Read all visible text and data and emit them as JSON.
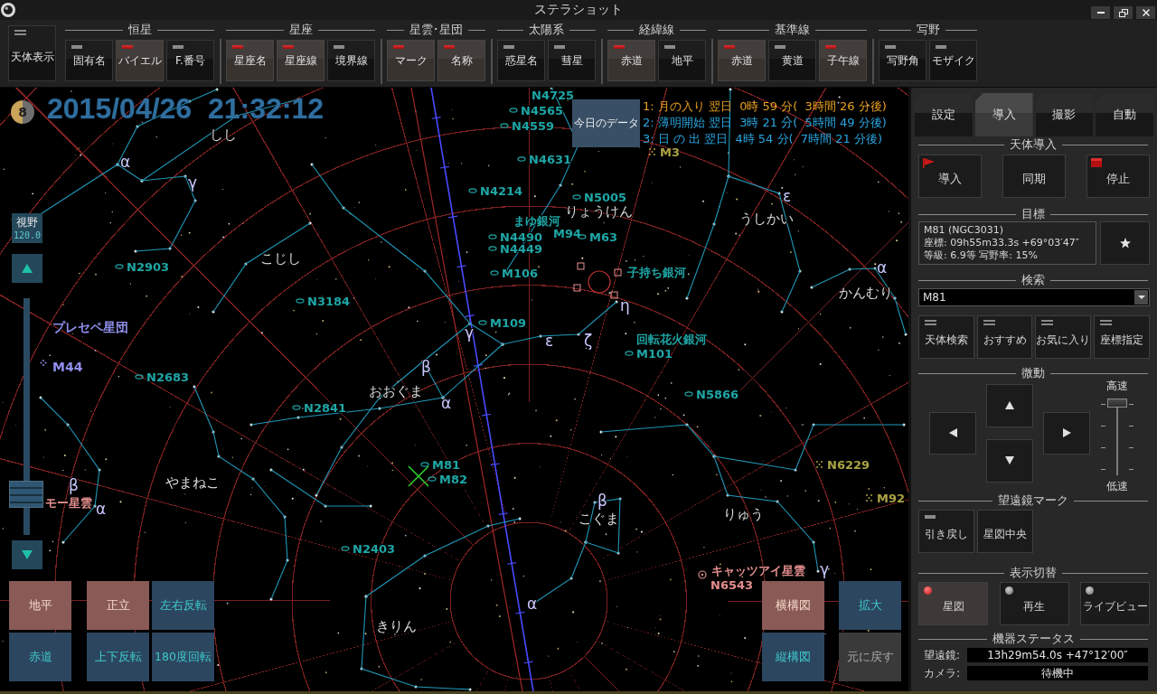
{
  "window": {
    "title": "ステラショット"
  },
  "toolbar": {
    "main": {
      "label": "天体表示",
      "on": false
    },
    "groups": [
      {
        "title": "恒星",
        "buttons": [
          {
            "label": "固有名",
            "on": false
          },
          {
            "label": "バイエル",
            "on": true
          },
          {
            "label": "F.番号",
            "on": false
          }
        ]
      },
      {
        "title": "星座",
        "buttons": [
          {
            "label": "星座名",
            "on": true
          },
          {
            "label": "星座線",
            "on": true
          },
          {
            "label": "境界線",
            "on": false
          }
        ]
      },
      {
        "title": "星雲･星団",
        "buttons": [
          {
            "label": "マーク",
            "on": true
          },
          {
            "label": "名称",
            "on": true
          }
        ]
      },
      {
        "title": "太陽系",
        "buttons": [
          {
            "label": "惑星名",
            "on": false
          },
          {
            "label": "彗星",
            "on": false
          }
        ]
      },
      {
        "title": "経緯線",
        "buttons": [
          {
            "label": "赤道",
            "on": true
          },
          {
            "label": "地平",
            "on": false
          }
        ]
      },
      {
        "title": "基準線",
        "buttons": [
          {
            "label": "赤道",
            "on": true
          },
          {
            "label": "黄道",
            "on": false
          },
          {
            "label": "子午線",
            "on": true
          }
        ]
      },
      {
        "title": "写野",
        "buttons": [
          {
            "label": "写野角",
            "on": false
          },
          {
            "label": "モザイク",
            "on": false
          }
        ]
      }
    ]
  },
  "chart": {
    "moon_age": "8",
    "datetime": "2015/04/26  21:32:12",
    "todays_data": "今日のデータ",
    "events": [
      {
        "text": "1: 月の入り 翌日  0時 59 分(  3時間 26 分後)",
        "color": "#e8a020"
      },
      {
        "text": "2: 薄明開始 翌日  3時 21 分(  5時間 49 分後)",
        "color": "#2aa6e0"
      },
      {
        "text": "3: 日 の 出 翌日  4時 54 分(  7時間 21 分後)",
        "color": "#2aa6e0"
      }
    ],
    "field_of_view": {
      "label": "視野",
      "value": "120.0"
    },
    "zoom_slider": {
      "level": 0.13
    },
    "labels": [
      {
        "text": "しし",
        "kind": "constellation"
      },
      {
        "text": "こじし",
        "kind": "constellation"
      },
      {
        "text": "りょうけん",
        "kind": "constellation"
      },
      {
        "text": "うしかい",
        "kind": "constellation"
      },
      {
        "text": "かんむり",
        "kind": "constellation"
      },
      {
        "text": "おおぐま",
        "kind": "constellation"
      },
      {
        "text": "やまねこ",
        "kind": "constellation"
      },
      {
        "text": "こぐま",
        "kind": "constellation"
      },
      {
        "text": "りゅう",
        "kind": "constellation"
      },
      {
        "text": "きりん",
        "kind": "constellation"
      },
      {
        "text": "N4725",
        "kind": "galaxy_name"
      },
      {
        "text": "N4565",
        "kind": "galaxy"
      },
      {
        "text": "N4559",
        "kind": "galaxy"
      },
      {
        "text": "N4631",
        "kind": "galaxy"
      },
      {
        "text": "N4214",
        "kind": "galaxy"
      },
      {
        "text": "N5005",
        "kind": "galaxy"
      },
      {
        "text": "まゆ銀河",
        "kind": "galaxy_name"
      },
      {
        "text": "N4490",
        "kind": "galaxy"
      },
      {
        "text": "M94",
        "kind": "galaxy_name"
      },
      {
        "text": "M63",
        "kind": "galaxy"
      },
      {
        "text": "N4449",
        "kind": "galaxy"
      },
      {
        "text": "M106",
        "kind": "galaxy"
      },
      {
        "text": "子持ち銀河",
        "kind": "galaxy_name"
      },
      {
        "text": "M109",
        "kind": "galaxy"
      },
      {
        "text": "回転花火銀河",
        "kind": "galaxy_name"
      },
      {
        "text": "M101",
        "kind": "galaxy"
      },
      {
        "text": "N3184",
        "kind": "galaxy"
      },
      {
        "text": "N2903",
        "kind": "galaxy"
      },
      {
        "text": "N2683",
        "kind": "galaxy"
      },
      {
        "text": "N2841",
        "kind": "galaxy"
      },
      {
        "text": "N5866",
        "kind": "galaxy"
      },
      {
        "text": "M81",
        "kind": "galaxy"
      },
      {
        "text": "M82",
        "kind": "galaxy"
      },
      {
        "text": "N2403",
        "kind": "galaxy"
      },
      {
        "text": "M3",
        "kind": "globular"
      },
      {
        "text": "N6229",
        "kind": "globular"
      },
      {
        "text": "M92",
        "kind": "globular"
      },
      {
        "text": "キャッツアイ星雲",
        "kind": "nebula_name"
      },
      {
        "text": "N6543",
        "kind": "nebula"
      },
      {
        "text": "プレセペ星団",
        "kind": "open_cluster_name"
      },
      {
        "text": "M44",
        "kind": "open_cluster"
      },
      {
        "text": "モー星雲",
        "kind": "nebula_name"
      },
      {
        "text": "α",
        "kind": "star"
      },
      {
        "text": "γ",
        "kind": "star"
      },
      {
        "text": "ε",
        "kind": "star"
      },
      {
        "text": "α",
        "kind": "star"
      },
      {
        "text": "η",
        "kind": "star"
      },
      {
        "text": "γ",
        "kind": "star"
      },
      {
        "text": "ε",
        "kind": "star"
      },
      {
        "text": "ζ",
        "kind": "star"
      },
      {
        "text": "β",
        "kind": "star"
      },
      {
        "text": "α",
        "kind": "star"
      },
      {
        "text": "β",
        "kind": "star"
      },
      {
        "text": "α",
        "kind": "star"
      },
      {
        "text": "β",
        "kind": "star"
      },
      {
        "text": "α",
        "kind": "star"
      },
      {
        "text": "γ",
        "kind": "star"
      }
    ],
    "mount_buttons": [
      {
        "label": "地平",
        "selected": true
      },
      {
        "label": "赤道",
        "selected": false
      }
    ],
    "orientation_buttons": [
      {
        "label": "正立",
        "selected": true
      },
      {
        "label": "左右反転",
        "selected": false
      },
      {
        "label": "上下反転",
        "selected": false
      },
      {
        "label": "180度回転",
        "selected": false
      }
    ],
    "composition_buttons": [
      {
        "label": "横構図",
        "selected": true
      },
      {
        "label": "縦構図",
        "selected": false
      }
    ],
    "zoom_buttons": [
      {
        "label": "拡大",
        "disabled": false
      },
      {
        "label": "元に戻す",
        "disabled": true
      }
    ]
  },
  "panel": {
    "tabs": [
      {
        "label": "設定",
        "selected": false
      },
      {
        "label": "導入",
        "selected": true
      },
      {
        "label": "撮影",
        "selected": false
      },
      {
        "label": "自動",
        "selected": false
      }
    ],
    "goto": {
      "title": "天体導入",
      "buttons": [
        {
          "label": "導入",
          "kind": "goto"
        },
        {
          "label": "同期",
          "kind": "sync"
        },
        {
          "label": "停止",
          "kind": "stop"
        }
      ]
    },
    "target": {
      "title": "目標",
      "lines": [
        "M81 (NGC3031)",
        "座標: 09h55m33.3s +69°03′47″",
        "等級: 6.9等 写野率: 15%"
      ]
    },
    "search": {
      "title": "検索",
      "value": "M81",
      "buttons": [
        {
          "label": "天体検索",
          "on": false
        },
        {
          "label": "おすすめ",
          "on": false
        },
        {
          "label": "お気に入り",
          "on": false
        },
        {
          "label": "座標指定",
          "on": false
        }
      ]
    },
    "jog": {
      "title": "微動",
      "high_label": "高速",
      "low_label": "低速",
      "speed": {
        "level": 1
      }
    },
    "telescope_mark": {
      "title": "望遠鏡マーク",
      "buttons": [
        {
          "label": "引き戻し",
          "kind": "toggle",
          "on": false
        },
        {
          "label": "星図中央",
          "kind": "action"
        }
      ]
    },
    "display": {
      "title": "表示切替",
      "buttons": [
        {
          "label": "星図",
          "selected": true
        },
        {
          "label": "再生",
          "selected": false
        },
        {
          "label": "ライブビュー",
          "selected": false
        }
      ]
    },
    "status": {
      "title": "機器ステータス",
      "rows": [
        {
          "label": "望遠鏡:",
          "value": "13h29m54.0s +47°12′00″"
        },
        {
          "label": "カメラ:",
          "value": "待機中"
        }
      ]
    }
  }
}
